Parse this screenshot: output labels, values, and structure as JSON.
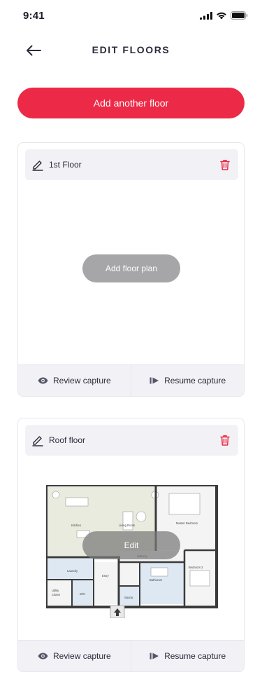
{
  "status_bar": {
    "time": "9:41"
  },
  "nav": {
    "title": "EDIT FLOORS"
  },
  "add_floor_button": "Add another floor",
  "floors": [
    {
      "name": "1st Floor",
      "plan_button": "Add floor plan",
      "review_label": "Review capture",
      "resume_label": "Resume capture"
    },
    {
      "name": "Roof floor",
      "plan_button": "Edit",
      "review_label": "Review capture",
      "resume_label": "Resume capture",
      "plan_rooms": [
        "Kitchen",
        "Living Room",
        "Master Bedroom",
        "Hallway",
        "Bedroom 2",
        "Laundry",
        "Entry",
        "Bathroom",
        "Utility Closet",
        "W/C",
        "Sauna"
      ]
    }
  ],
  "colors": {
    "accent": "#ec2946",
    "card_border": "#e5e6ec",
    "panel_bg": "#f2f2f6"
  },
  "icons": [
    "back-arrow-icon",
    "pencil-icon",
    "trash-icon",
    "eye-icon",
    "resume-play-icon",
    "signal-icon",
    "wifi-icon",
    "battery-icon"
  ]
}
